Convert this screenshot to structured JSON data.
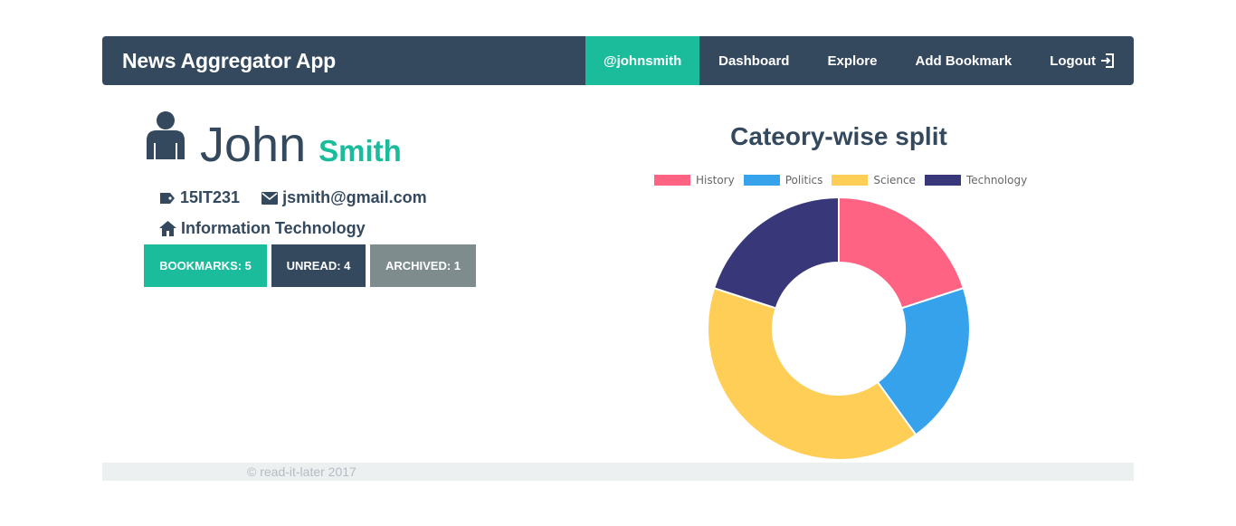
{
  "navbar": {
    "brand": "News Aggregator App",
    "items": [
      {
        "label": "@johnsmith"
      },
      {
        "label": "Dashboard"
      },
      {
        "label": "Explore"
      },
      {
        "label": "Add Bookmark"
      },
      {
        "label": "Logout"
      }
    ]
  },
  "profile": {
    "first_name": "John",
    "last_name": "Smith",
    "id": "15IT231",
    "email": "jsmith@gmail.com",
    "department": "Information Technology"
  },
  "stats": {
    "bookmarks": "BOOKMARKS: 5",
    "unread": "UNREAD: 4",
    "archived": "ARCHIVED: 1"
  },
  "footer": {
    "text": "© read-it-later 2017"
  },
  "colors": {
    "accent": "#1abc9c",
    "primary": "#34495e",
    "muted": "#7f8c8d"
  },
  "chart_data": {
    "type": "pie",
    "variant": "doughnut",
    "title": "Cateory-wise split",
    "categories": [
      "History",
      "Politics",
      "Science",
      "Technology"
    ],
    "values": [
      1,
      1,
      2,
      1
    ],
    "colors": [
      "#ff6384",
      "#36a2eb",
      "#ffce56",
      "#37377a"
    ],
    "legend_position": "top"
  }
}
